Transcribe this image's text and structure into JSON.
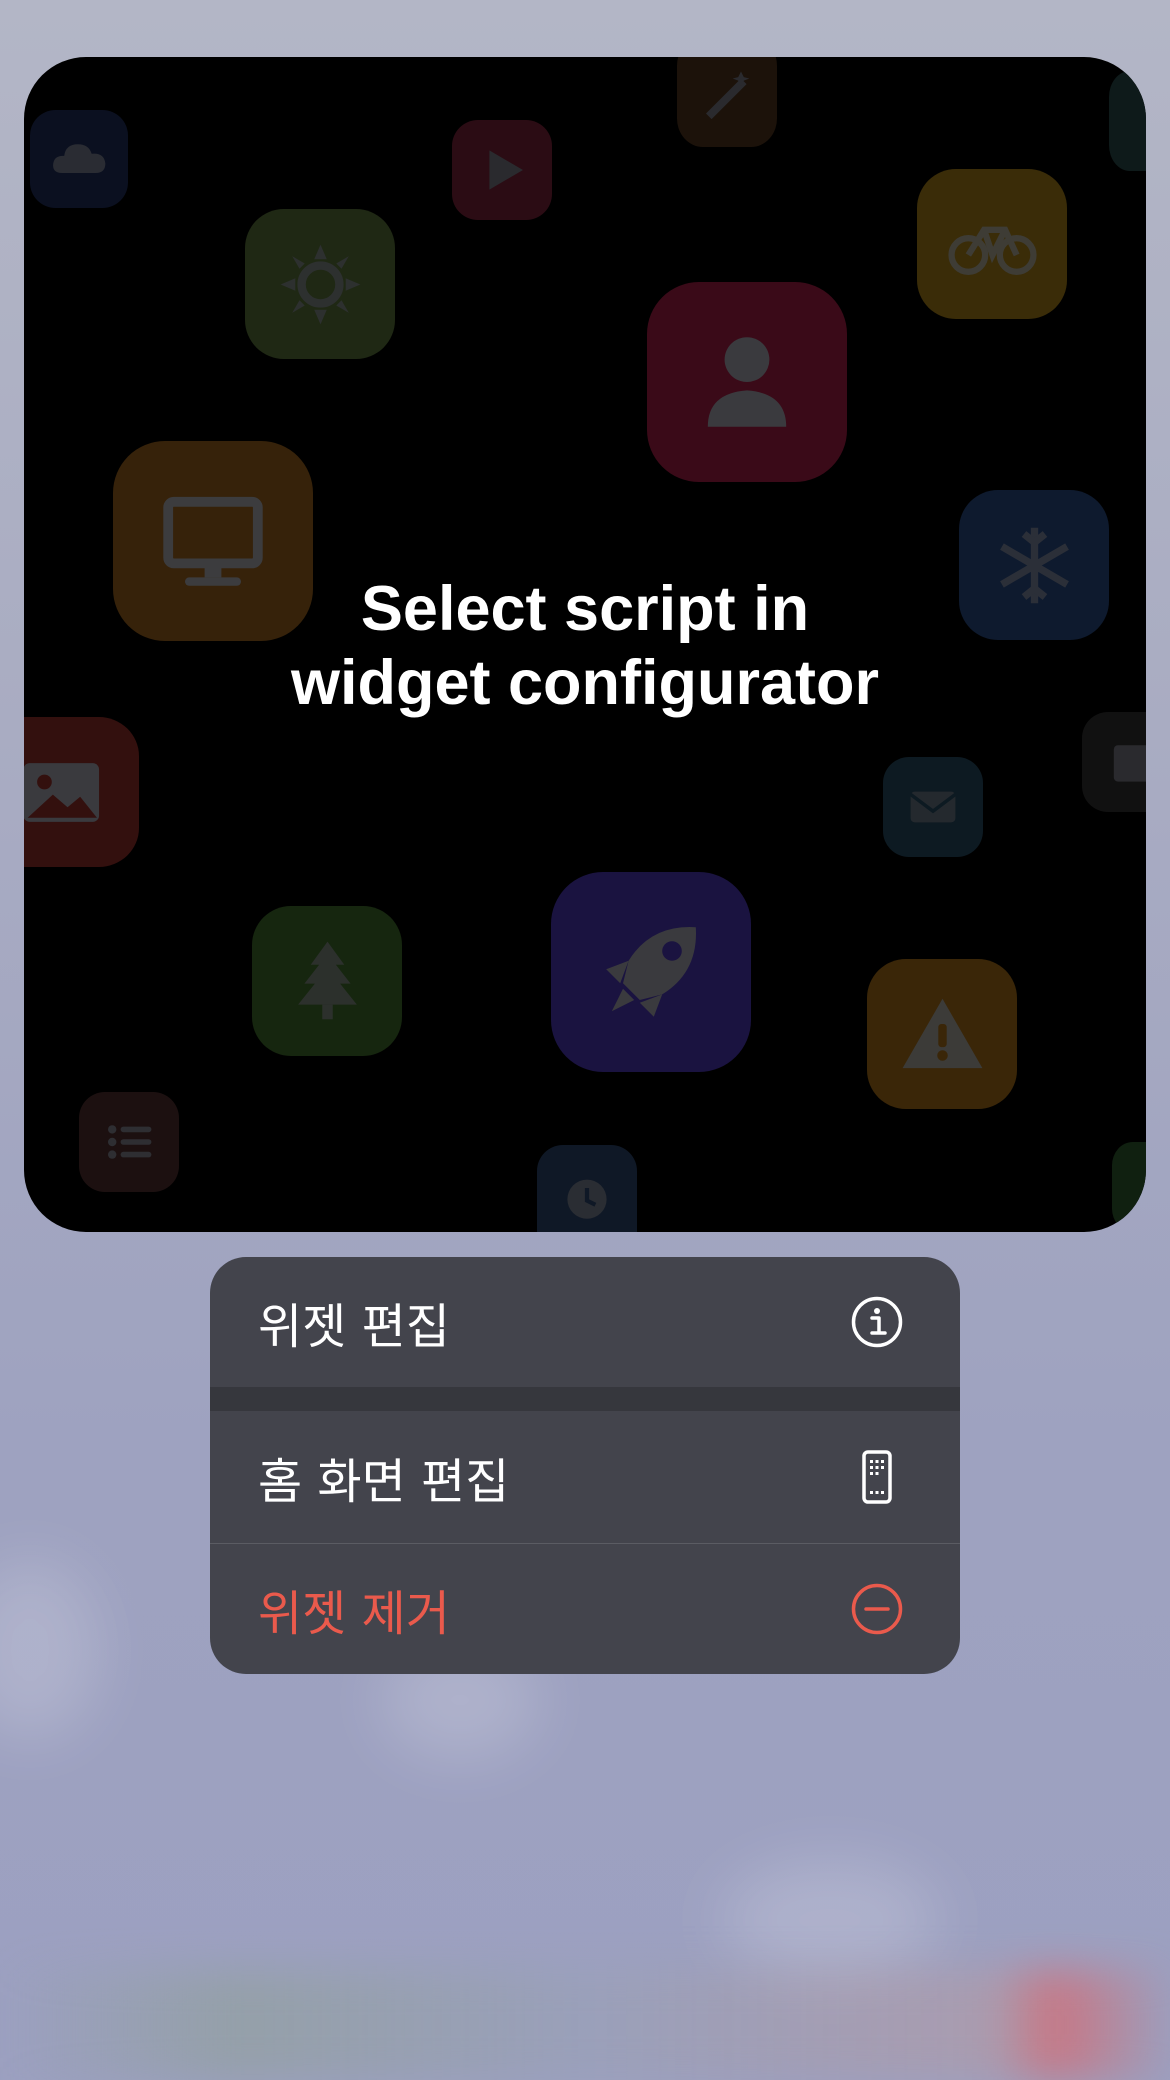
{
  "widget": {
    "message_line1": "Select script in",
    "message_line2": "widget configurator",
    "background_icons": [
      "cloud-icon",
      "play-icon",
      "magic-wand-icon",
      "sun-icon",
      "bicycle-icon",
      "person-icon",
      "desktop-icon",
      "snowflake-icon",
      "photo-icon",
      "calendar-icon",
      "mail-icon",
      "tree-icon",
      "rocket-icon",
      "warning-icon",
      "list-icon",
      "clock-icon"
    ]
  },
  "context_menu": {
    "items": [
      {
        "label": "위젯 편집",
        "icon": "info-icon",
        "destructive": false
      },
      {
        "label": "홈 화면 편집",
        "icon": "phone-grid-icon",
        "destructive": false
      },
      {
        "label": "위젯 제거",
        "icon": "minus-circle-icon",
        "destructive": true
      }
    ]
  },
  "colors": {
    "destructive": "#ea5a4c",
    "menu_background": "#43444c",
    "widget_background": "#000000"
  }
}
